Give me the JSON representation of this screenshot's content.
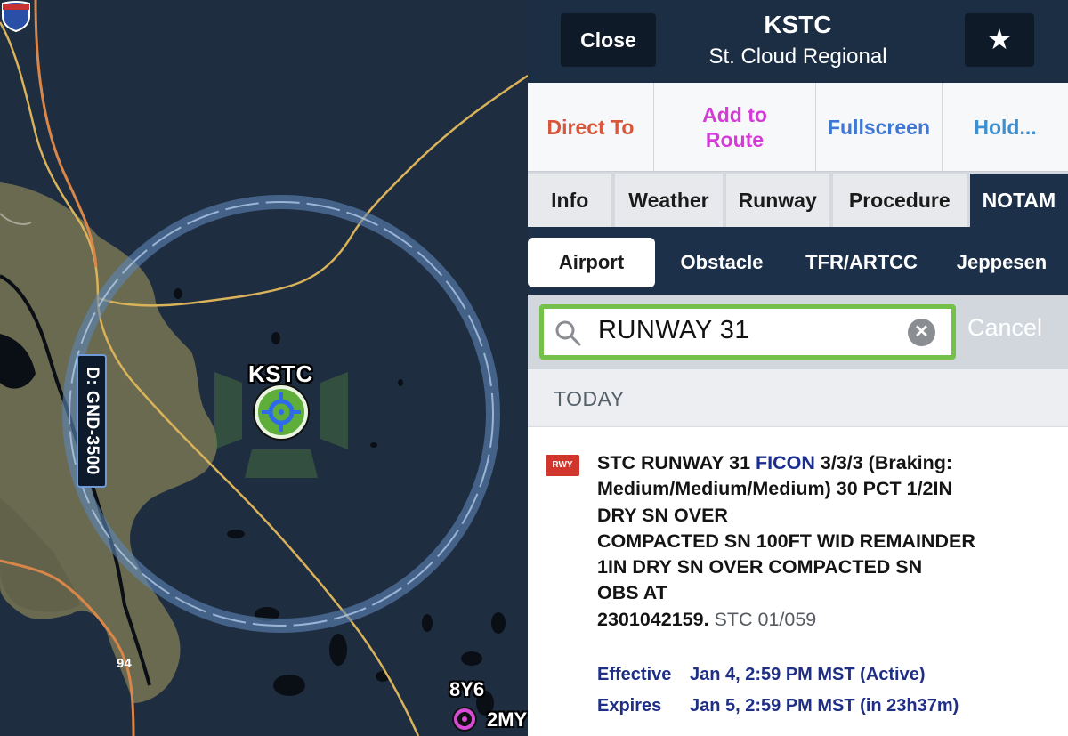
{
  "map": {
    "airport_code": "KSTC",
    "airspace_tag": "D: GND-3500",
    "highway_number": "94",
    "waypoints": [
      "8Y6",
      "2MY"
    ]
  },
  "header": {
    "close_label": "Close",
    "title": "KSTC",
    "subtitle": "St. Cloud Regional",
    "star_label": "★"
  },
  "actions": [
    {
      "label": "Direct To",
      "color": "#d8563a"
    },
    {
      "label": "Add to Route",
      "color": "#d43bd8"
    },
    {
      "label": "Fullscreen",
      "color": "#3e77d6"
    },
    {
      "label": "Hold...",
      "color": "#3c8fd0"
    }
  ],
  "tabs": [
    "Info",
    "Weather",
    "Runway",
    "Procedure",
    "NOTAM"
  ],
  "active_tab": "NOTAM",
  "subtabs": [
    "Airport",
    "Obstacle",
    "TFR/ARTCC",
    "Jeppesen"
  ],
  "active_subtab": "Airport",
  "search": {
    "value": "RUNWAY 31",
    "cancel_label": "Cancel"
  },
  "section_header": "TODAY",
  "notam": {
    "badge": "RWY",
    "prefix": "STC RUNWAY 31 ",
    "ficon": "FICON",
    "line1_rest": " 3/3/3 (Braking:",
    "line2": "Medium/Medium/Medium) 30 PCT 1/2IN",
    "line3": "DRY SN OVER",
    "line4": "COMPACTED SN 100FT WID REMAINDER",
    "line5": "1IN DRY SN OVER COMPACTED SN",
    "line6": "OBS AT",
    "line7": "2301042159.",
    "reference": " STC 01/059",
    "effective_label": "Effective",
    "effective_value": "Jan 4, 2:59 PM MST (Active)",
    "expires_label": "Expires",
    "expires_value": "Jan 5, 2:59 PM MST (in 23h37m)"
  }
}
